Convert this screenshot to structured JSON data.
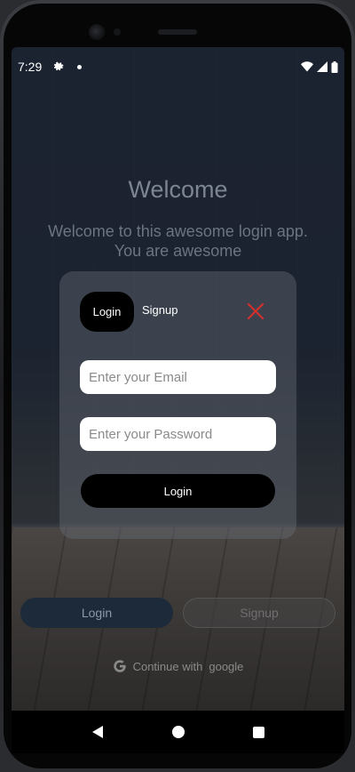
{
  "status_bar": {
    "time": "7:29",
    "icons": [
      "gear-icon",
      "notification-dot-icon",
      "wifi-icon",
      "signal-icon",
      "battery-icon"
    ]
  },
  "background": {
    "title": "Welcome",
    "subtitle_line1": "Welcome to this awesome login app.",
    "subtitle_line2": "You are awesome",
    "login_button": "Login",
    "signup_button": "Signup",
    "google_prefix": "Continue with",
    "google_name": "google"
  },
  "modal": {
    "tab_login": "Login",
    "tab_signup": "Signup",
    "email_placeholder": "Enter your Email",
    "password_placeholder": "Enter your Password",
    "submit_label": "Login",
    "close_color": "#d0312d"
  },
  "nav_bar": {
    "icons": [
      "back-icon",
      "home-icon",
      "recents-icon"
    ]
  }
}
